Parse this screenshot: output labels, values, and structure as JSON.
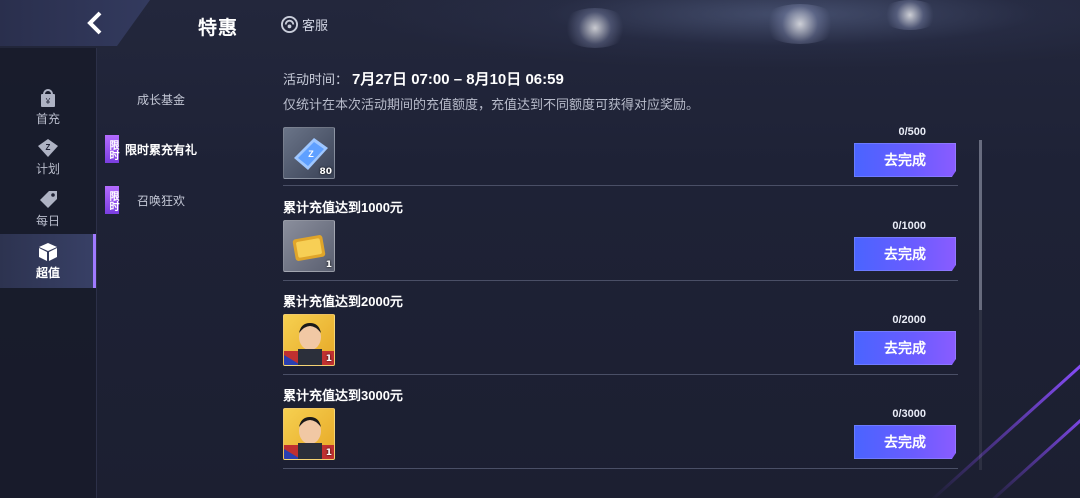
{
  "header": {
    "title": "特惠",
    "customer_service_label": "客服"
  },
  "left_nav": {
    "items": [
      {
        "label": "首充",
        "icon": "bag-icon"
      },
      {
        "label": "计划",
        "icon": "diamond-z-icon"
      },
      {
        "label": "每日",
        "icon": "tag-icon"
      },
      {
        "label": "超值",
        "icon": "cube-icon",
        "active": true
      }
    ]
  },
  "sub_nav": {
    "items": [
      {
        "label": "成长基金",
        "badge": ""
      },
      {
        "label": "限时累充有礼",
        "badge": "限时",
        "active": true
      },
      {
        "label": "召唤狂欢",
        "badge": "限时"
      }
    ]
  },
  "event": {
    "time_label": "活动时间：",
    "time_value": "7月27日 07:00 – 8月10日 06:59",
    "description": "仅统计在本次活动期间的充值额度，充值达到不同额度可获得对应奖励。"
  },
  "tiers": [
    {
      "title": "",
      "progress": "0/500",
      "button": "去完成",
      "reward_count": "80",
      "reward_icon": "blue-ticket-icon"
    },
    {
      "title": "累计充值达到1000元",
      "progress": "0/1000",
      "button": "去完成",
      "reward_count": "1",
      "reward_icon": "gold-card-icon"
    },
    {
      "title": "累计充值达到2000元",
      "progress": "0/2000",
      "button": "去完成",
      "reward_count": "1",
      "reward_icon": "player-card-icon"
    },
    {
      "title": "累计充值达到3000元",
      "progress": "0/3000",
      "button": "去完成",
      "reward_count": "1",
      "reward_icon": "player-card-icon"
    }
  ],
  "colors": {
    "accent_purple": "#8a4dff",
    "button_blue": "#4a64ff",
    "badge_purple": "#b36bff"
  }
}
